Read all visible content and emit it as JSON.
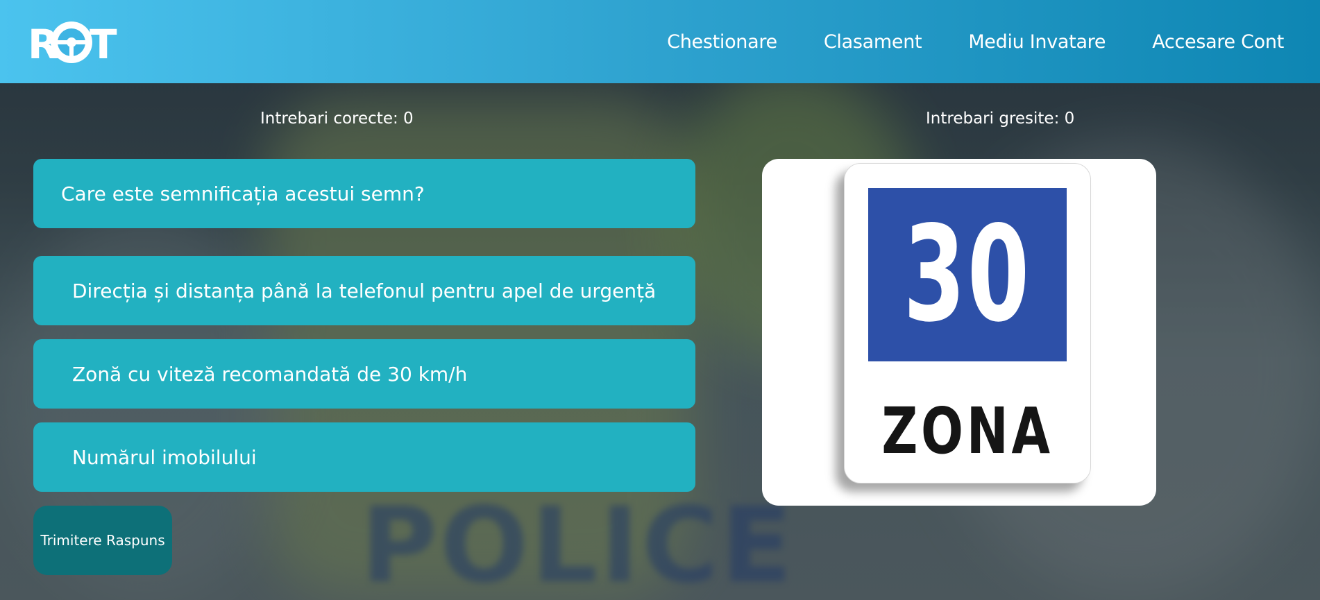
{
  "header": {
    "logo_text": "ROT",
    "nav": [
      "Chestionare",
      "Clasament",
      "Mediu Invatare",
      "Accesare Cont"
    ]
  },
  "stats": {
    "correct": "Intrebari corecte: 0",
    "wrong": "Intrebari gresite: 0"
  },
  "question": {
    "text": "Care este semnificația acestui semn?"
  },
  "answers": [
    "Direcția și distanța până la telefonul pentru apel de urgență",
    "Zonă cu viteză recomandată de 30 km/h",
    "Numărul imobilului"
  ],
  "submit_label": "Trimitere Raspuns",
  "sign": {
    "number": "30",
    "caption": "ZONA",
    "blue_color": "#2d50a8"
  },
  "background_text": "POLICE",
  "colors": {
    "header_start": "#4bc3ee",
    "header_end": "#0e86b3",
    "answer_bg": "#22b1c1",
    "submit_bg": "#0d7078"
  }
}
